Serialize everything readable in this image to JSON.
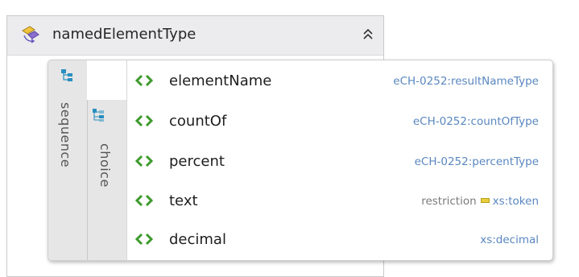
{
  "complex_type": {
    "name": "namedElementType",
    "icon": "complex-type-icon",
    "collapse_icon": "chevron-double-up-icon"
  },
  "sequence": {
    "label": "sequence",
    "icon": "sequence-compositor-icon"
  },
  "choice": {
    "label": "choice",
    "icon": "choice-compositor-icon"
  },
  "elements": [
    {
      "name": "elementName",
      "type": "eCH-0252:resultNameType"
    },
    {
      "name": "countOf",
      "type": "eCH-0252:countOfType"
    },
    {
      "name": "percent",
      "type": "eCH-0252:percentType"
    },
    {
      "name": "text",
      "restriction_label": "restriction",
      "type": "xs:token"
    },
    {
      "name": "decimal",
      "type": "xs:decimal"
    }
  ],
  "colors": {
    "type_text": "#5a87bf",
    "element_icon": "#3f9a2e",
    "compositor_icon": "#2a8fbf",
    "restriction_marker": "#e8cd3c"
  }
}
